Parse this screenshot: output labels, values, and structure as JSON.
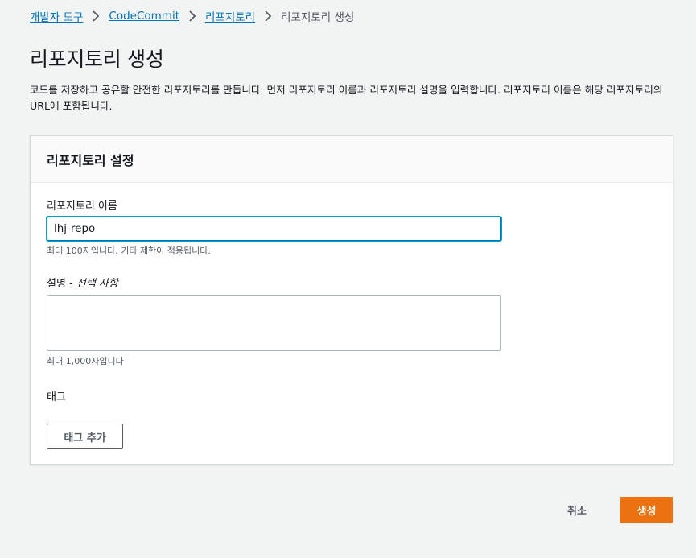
{
  "breadcrumb": {
    "items": [
      "개발자 도구",
      "CodeCommit",
      "리포지토리"
    ],
    "current": "리포지토리 생성"
  },
  "page": {
    "title": "리포지토리 생성",
    "description": "코드를 저장하고 공유할 안전한 리포지토리를 만듭니다. 먼저 리포지토리 이름과 리포지토리 설명을 입력합니다. 리포지토리 이름은 해당 리포지토리의 URL에 포함됩니다."
  },
  "settings": {
    "title": "리포지토리 설정",
    "name_label": "리포지토리 이름",
    "name_value": "lhj-repo",
    "name_hint": "최대 100자입니다. 기타 제한이 적용됩니다.",
    "desc_label": "설명",
    "desc_optional": " - 선택 사항",
    "desc_value": "",
    "desc_hint": "최대 1,000자입니다",
    "tags_label": "태그",
    "add_tag_button": "태그 추가"
  },
  "actions": {
    "cancel": "취소",
    "create": "생성"
  },
  "colors": {
    "link": "#0073bb",
    "primary": "#ec7211",
    "background": "#f2f3f3",
    "focus_border": "#0073bb"
  }
}
